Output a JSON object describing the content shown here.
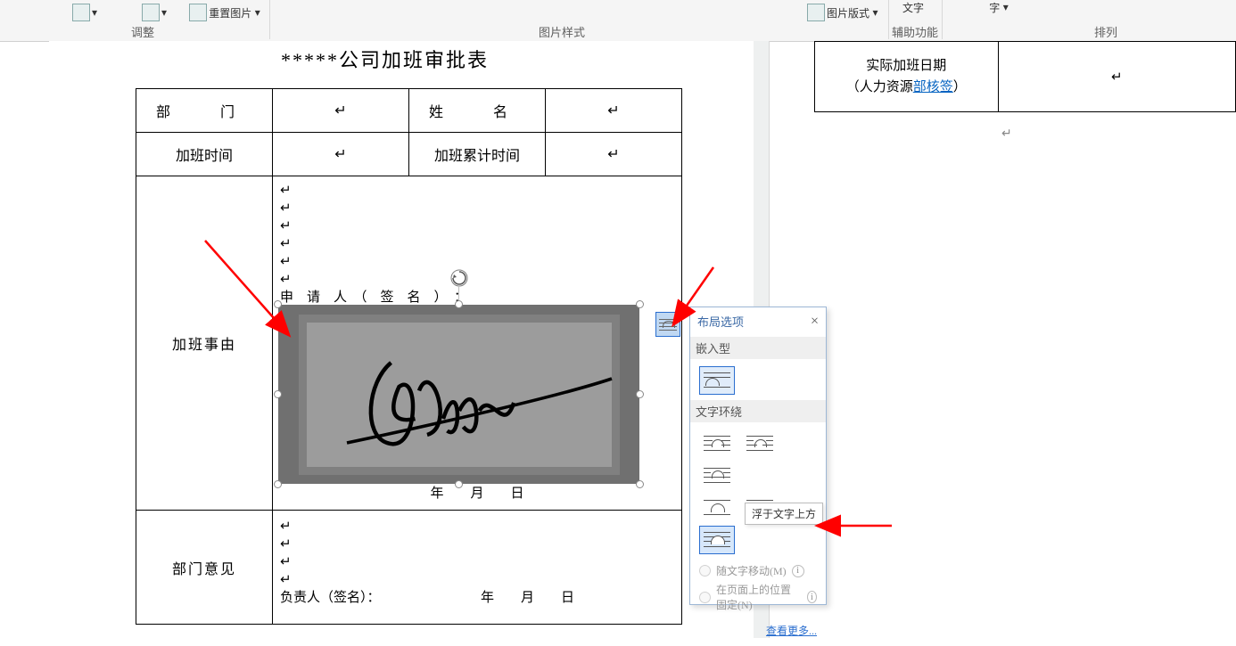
{
  "ribbon": {
    "reset_picture": "重置图片",
    "group_adjust": "调整",
    "group_picture_style": "图片样式",
    "picture_layout": "图片版式",
    "text_wrap": "文字",
    "text_wrap2": "字",
    "group_assistive": "辅助功能",
    "group_arrange": "排列"
  },
  "doc": {
    "title": "*****公司加班审批表",
    "row1": {
      "dept": "部　门",
      "name": "姓　名"
    },
    "row2": {
      "time": "加班时间",
      "total": "加班累计时间"
    },
    "reason_label": "加班事由",
    "reason_line": "申　请　人　（　签　名　）　：",
    "date_line": "年　　月　　日",
    "opinion_label": "部门意见",
    "opinion_line": "负责人（签名）：　　　　　　　　年　　月　　日"
  },
  "popup": {
    "title": "布局选项",
    "sect_inline": "嵌入型",
    "sect_wrap": "文字环绕",
    "opt_inline": "嵌入型",
    "opt_square": "方形",
    "opt_tight": "紧密型",
    "opt_through": "穿越型",
    "opt_topbottom": "上下型",
    "opt_behind": "衬于文字下方",
    "opt_front": "浮于文字上方",
    "radio_move": "随文字移动(M)",
    "radio_fixed": "在页面上的位置固定(N)",
    "more": "查看更多..."
  },
  "tooltip": "浮于文字上方",
  "layout_button": "布局选项",
  "page2": {
    "left1": "实际加班日期",
    "left2_a": "（人力资源",
    "left2_link": "部核签",
    "left2_b": "）"
  }
}
